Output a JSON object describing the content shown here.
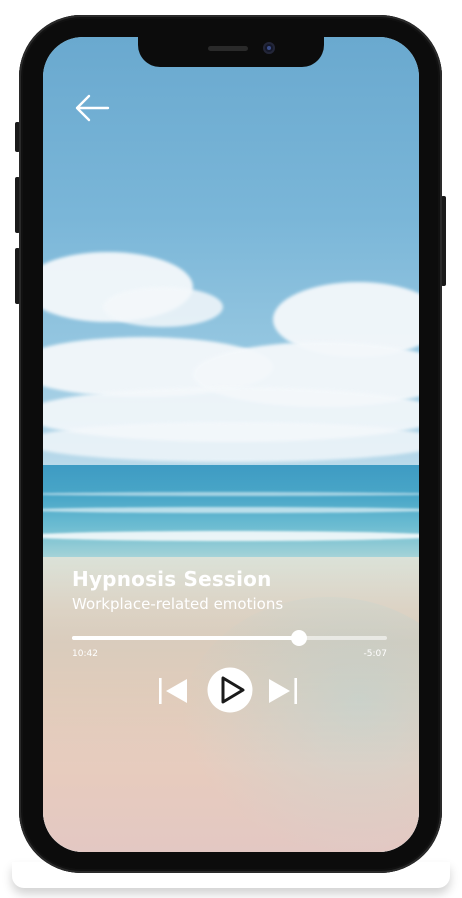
{
  "session": {
    "title": "Hypnosis Session",
    "subtitle": "Workplace-related emotions"
  },
  "player": {
    "elapsed": "10:42",
    "remaining": "-5:07",
    "progress_fraction": 0.72,
    "state": "paused"
  },
  "icons": {
    "back": "arrow-left-icon",
    "previous": "skip-previous-icon",
    "play": "play-icon",
    "next": "skip-next-icon"
  },
  "colors": {
    "text": "#ffffff",
    "track": "rgba(255,255,255,0.55)",
    "track_fill": "#ffffff"
  }
}
